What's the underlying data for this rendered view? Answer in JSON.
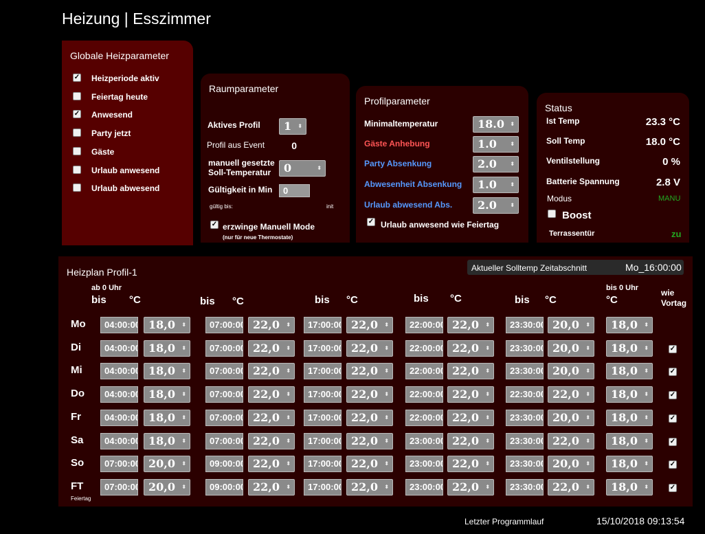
{
  "page_title": "Heizung | Esszimmer",
  "global": {
    "title": "Globale Heizparameter",
    "items": [
      {
        "label": "Heizperiode aktiv",
        "checked": true
      },
      {
        "label": "Feiertag heute",
        "checked": false
      },
      {
        "label": "Anwesend",
        "checked": true
      },
      {
        "label": "Party jetzt",
        "checked": false
      },
      {
        "label": "Gäste",
        "checked": false
      },
      {
        "label": "Urlaub anwesend",
        "checked": false
      },
      {
        "label": "Urlaub abwesend",
        "checked": false
      }
    ]
  },
  "room": {
    "title": "Raumparameter",
    "aktives_profil_label": "Aktives Profil",
    "aktives_profil_value": "1",
    "profil_event_label": "Profil aus Event",
    "profil_event_value": "0",
    "manuell_label_1": "manuell gesetzte",
    "manuell_label_2": "Soll-Temperatur",
    "manuell_value": "0",
    "gueltig_label": "Gültigkeit in Min",
    "gueltig_value": "0",
    "gueltig_bis_label": "gültig bis:",
    "gueltig_bis_value": "init",
    "force_label": "erzwinge Manuell Mode",
    "force_note": "(nur für neue Thermostate)",
    "force_checked": true
  },
  "profile": {
    "title": "Profilparameter",
    "rows": [
      {
        "label": "Minimaltemperatur",
        "value": "18.0",
        "color": "#ffffff"
      },
      {
        "label": "Gäste Anhebung",
        "value": "1.0",
        "color": "#ff5555"
      },
      {
        "label": "Party Absenkung",
        "value": "2.0",
        "color": "#5599ff"
      },
      {
        "label": "Abwesenheit Absenkung",
        "value": "1.0",
        "color": "#5599ff"
      },
      {
        "label": "Urlaub abwesend Abs.",
        "value": "2.0",
        "color": "#5599ff"
      }
    ],
    "feiertag_label": "Urlaub anwesend wie Feiertag",
    "feiertag_checked": true
  },
  "status": {
    "title": "Status",
    "rows": [
      {
        "label": "Ist Temp",
        "value": "23.3 °C"
      },
      {
        "label": "Soll Temp",
        "value": "18.0 °C"
      },
      {
        "label": "Ventilstellung",
        "value": "0 %"
      },
      {
        "label": "Batterie Spannung",
        "value": "2.8 V"
      }
    ],
    "modus_label": "Modus",
    "modus_value": "MANU",
    "boost_label": "Boost",
    "boost_checked": false,
    "tuer_label": "Terrassentür",
    "tuer_value": "zu",
    "green": "#22aa22"
  },
  "plan": {
    "title": "Heizplan Profil-1",
    "current_label": "Aktueller Solltemp Zeitabschnitt",
    "current_value": "Mo_16:00:00",
    "ab0_label": "ab 0 Uhr",
    "bis0_label": "bis 0 Uhr",
    "bis_label": "bis",
    "deg_label": "°C",
    "wie_label_1": "wie",
    "wie_label_2": "Vortag",
    "ft_sub": "Feiertag",
    "days": [
      {
        "name": "Mo",
        "times": [
          "04:00:00",
          "07:00:00",
          "17:00:00",
          "22:00:00",
          "23:30:00"
        ],
        "temps": [
          "18,0",
          "22,0",
          "22,0",
          "22,0",
          "20,0",
          "18,0"
        ],
        "wie": null
      },
      {
        "name": "Di",
        "times": [
          "04:00:00",
          "07:00:00",
          "17:00:00",
          "22:00:00",
          "23:30:00"
        ],
        "temps": [
          "18,0",
          "22,0",
          "22,0",
          "22,0",
          "20,0",
          "18,0"
        ],
        "wie": true
      },
      {
        "name": "Mi",
        "times": [
          "04:00:00",
          "07:00:00",
          "17:00:00",
          "22:00:00",
          "23:30:00"
        ],
        "temps": [
          "18,0",
          "22,0",
          "22,0",
          "22,0",
          "20,0",
          "18,0"
        ],
        "wie": true
      },
      {
        "name": "Do",
        "times": [
          "04:00:00",
          "07:00:00",
          "17:00:00",
          "22:00:00",
          "22:30:00"
        ],
        "temps": [
          "18,0",
          "22,0",
          "22,0",
          "22,0",
          "22,0",
          "18,0"
        ],
        "wie": true
      },
      {
        "name": "Fr",
        "times": [
          "04:00:00",
          "07:00:00",
          "17:00:00",
          "22:00:00",
          "23:30:00"
        ],
        "temps": [
          "18,0",
          "22,0",
          "22,0",
          "22,0",
          "20,0",
          "18,0"
        ],
        "wie": true
      },
      {
        "name": "Sa",
        "times": [
          "04:00:00",
          "07:00:00",
          "17:00:00",
          "23:00:00",
          "23:30:00"
        ],
        "temps": [
          "18,0",
          "22,0",
          "22,0",
          "22,0",
          "22,0",
          "18,0"
        ],
        "wie": true
      },
      {
        "name": "So",
        "times": [
          "07:00:00",
          "09:00:00",
          "17:00:00",
          "23:00:00",
          "23:30:00"
        ],
        "temps": [
          "20,0",
          "22,0",
          "22,0",
          "22,0",
          "20,0",
          "18,0"
        ],
        "wie": true
      },
      {
        "name": "FT",
        "times": [
          "07:00:00",
          "09:00:00",
          "17:00:00",
          "23:00:00",
          "23:30:00"
        ],
        "temps": [
          "20,0",
          "22,0",
          "22,0",
          "22,0",
          "22,0",
          "18,0"
        ],
        "wie": true
      }
    ]
  },
  "footer": {
    "label": "Letzter Programmlauf",
    "value": "15/10/2018 09:13:54"
  }
}
